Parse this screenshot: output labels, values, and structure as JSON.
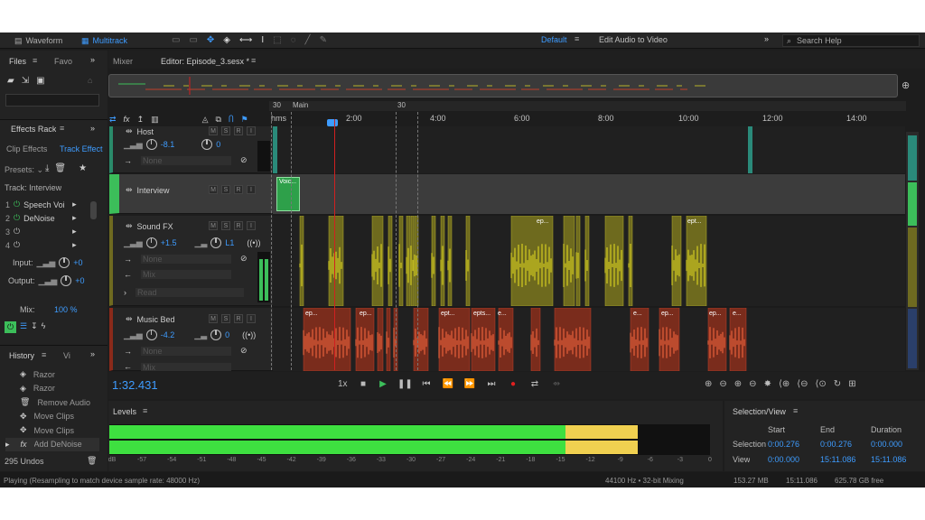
{
  "toolbar": {
    "waveform_label": "Waveform",
    "multitrack_label": "Multitrack",
    "workspace_label": "Default",
    "edit_video_label": "Edit Audio to Video",
    "search_placeholder": "Search Help"
  },
  "files_panel": {
    "tabs": [
      "Files",
      "Favo"
    ]
  },
  "effects_rack": {
    "title": "Effects Rack",
    "tabs": [
      "Clip Effects",
      "Track Effect"
    ],
    "presets_label": "Presets:",
    "track_label": "Track: Interview",
    "slots": [
      {
        "num": "1",
        "name": "Speech Voi",
        "on": true
      },
      {
        "num": "2",
        "name": "DeNoise",
        "on": true
      },
      {
        "num": "3",
        "name": "",
        "on": false
      },
      {
        "num": "4",
        "name": "",
        "on": false
      }
    ],
    "input_label": "Input:",
    "input_value": "+0",
    "output_label": "Output:",
    "output_value": "+0",
    "mix_label": "Mix:",
    "mix_value": "100 %"
  },
  "history": {
    "tabs": [
      "History",
      "Vi"
    ],
    "items": [
      "Razor",
      "Razor",
      "Remove Audio",
      "Move Clips",
      "Move Clips",
      "Add DeNoise"
    ],
    "undos": "295 Undos"
  },
  "editor": {
    "tabs": [
      "Mixer",
      "Editor: Episode_3.sesx *"
    ],
    "ruler": [
      "hms",
      "2:00",
      "4:00",
      "6:00",
      "8:00",
      "10:00",
      "12:00",
      "14:00"
    ],
    "markers": [
      "30",
      "Main",
      "30"
    ]
  },
  "tracks": [
    {
      "name": "Host",
      "volume": "-8.1",
      "pan": "0",
      "input": "None"
    },
    {
      "name": "Interview",
      "clip_label": "Voic..."
    },
    {
      "name": "Sound FX",
      "volume": "+1.5",
      "pan": "L1",
      "input": "None",
      "output": "Mix",
      "read": "Read",
      "clip_labels": [
        "ep...",
        "ept..."
      ]
    },
    {
      "name": "Music Bed",
      "volume": "-4.2",
      "pan": "0",
      "input": "None",
      "output": "Mix",
      "clip_labels": [
        "ep...",
        "ep...",
        "ept...",
        "epts...",
        "e...",
        "e...",
        "ep...",
        "ep...",
        "e..."
      ]
    }
  ],
  "transport": {
    "time": "1:32.431",
    "speed": "1x"
  },
  "levels": {
    "title": "Levels",
    "scale": [
      "dB",
      "-57",
      "-54",
      "-51",
      "-48",
      "-45",
      "-42",
      "-39",
      "-36",
      "-33",
      "-30",
      "-27",
      "-24",
      "-21",
      "-18",
      "-15",
      "-12",
      "-9",
      "-6",
      "-3",
      "0"
    ],
    "green_fraction": 0.76,
    "yellow_fraction": 0.12
  },
  "selection_view": {
    "title": "Selection/View",
    "headers": [
      "Start",
      "End",
      "Duration"
    ],
    "rows": [
      {
        "label": "Selection",
        "start": "0:00.276",
        "end": "0:00.276",
        "duration": "0:00.000"
      },
      {
        "label": "View",
        "start": "0:00.000",
        "end": "15:11.086",
        "duration": "15:11.086"
      }
    ]
  },
  "status": {
    "message": "Playing (Resampling to match device sample rate: 48000 Hz)",
    "sample_rate": "44100 Hz • 32-bit Mixing",
    "memory": "153.27 MB",
    "duration": "15:11.086",
    "free": "625.78 GB free"
  },
  "colors": {
    "accent": "#3e9cff",
    "sound_fx": "#b6b22a",
    "music": "#c0402a",
    "interview": "#3cbe5a",
    "playhead": "#d02020"
  }
}
